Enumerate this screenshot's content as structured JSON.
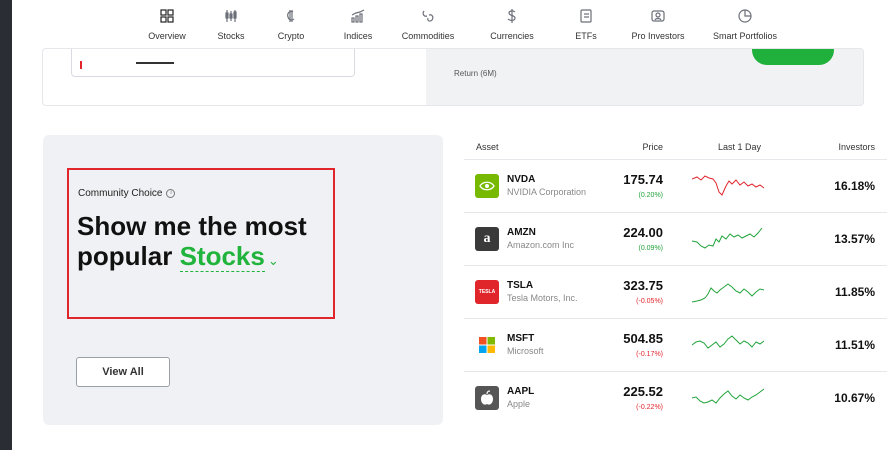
{
  "nav": {
    "items": [
      {
        "label": "Overview",
        "icon": "grid-icon"
      },
      {
        "label": "Stocks",
        "icon": "candles-icon"
      },
      {
        "label": "Crypto",
        "icon": "crypto-icon"
      },
      {
        "label": "Indices",
        "icon": "indices-icon"
      },
      {
        "label": "Commodities",
        "icon": "commodities-icon"
      },
      {
        "label": "Currencies",
        "icon": "dollar-icon"
      },
      {
        "label": "ETFs",
        "icon": "document-icon"
      },
      {
        "label": "Pro Investors",
        "icon": "pro-icon"
      },
      {
        "label": "Smart Portfolios",
        "icon": "pie-icon"
      }
    ],
    "active": "Overview"
  },
  "top_card": {
    "return_label": "Return (6M)"
  },
  "community": {
    "label": "Community Choice",
    "info_icon": "info-icon",
    "headline_prefix": "Show me the most popular",
    "headline_highlight": "Stocks",
    "view_all": "View All"
  },
  "table": {
    "headers": {
      "asset": "Asset",
      "price": "Price",
      "last_day": "Last 1 Day",
      "investors": "Investors"
    },
    "rows": [
      {
        "ticker": "NVDA",
        "company": "NVIDIA Corporation",
        "price": "175.74",
        "change": "(0.20%)",
        "direction": "up",
        "investors": "16.18%",
        "logo_color": "#76b900",
        "logo_text": ""
      },
      {
        "ticker": "AMZN",
        "company": "Amazon.com Inc",
        "price": "224.00",
        "change": "(0.09%)",
        "direction": "up",
        "investors": "13.57%",
        "logo_color": "#3a3a3a",
        "logo_text": "a"
      },
      {
        "ticker": "TSLA",
        "company": "Tesla Motors, Inc.",
        "price": "323.75",
        "change": "(-0.05%)",
        "direction": "down",
        "investors": "11.85%",
        "logo_color": "#e0252b",
        "logo_text": "TESLA"
      },
      {
        "ticker": "MSFT",
        "company": "Microsoft",
        "price": "504.85",
        "change": "(-0.17%)",
        "direction": "down",
        "investors": "11.51%",
        "logo_color": "#ffffff",
        "logo_text": ""
      },
      {
        "ticker": "AAPL",
        "company": "Apple",
        "price": "225.52",
        "change": "(-0.22%)",
        "direction": "down",
        "investors": "10.67%",
        "logo_color": "#555555",
        "logo_text": ""
      }
    ]
  },
  "colors": {
    "accent_green": "#21b43c",
    "negative_red": "#e0252b"
  }
}
